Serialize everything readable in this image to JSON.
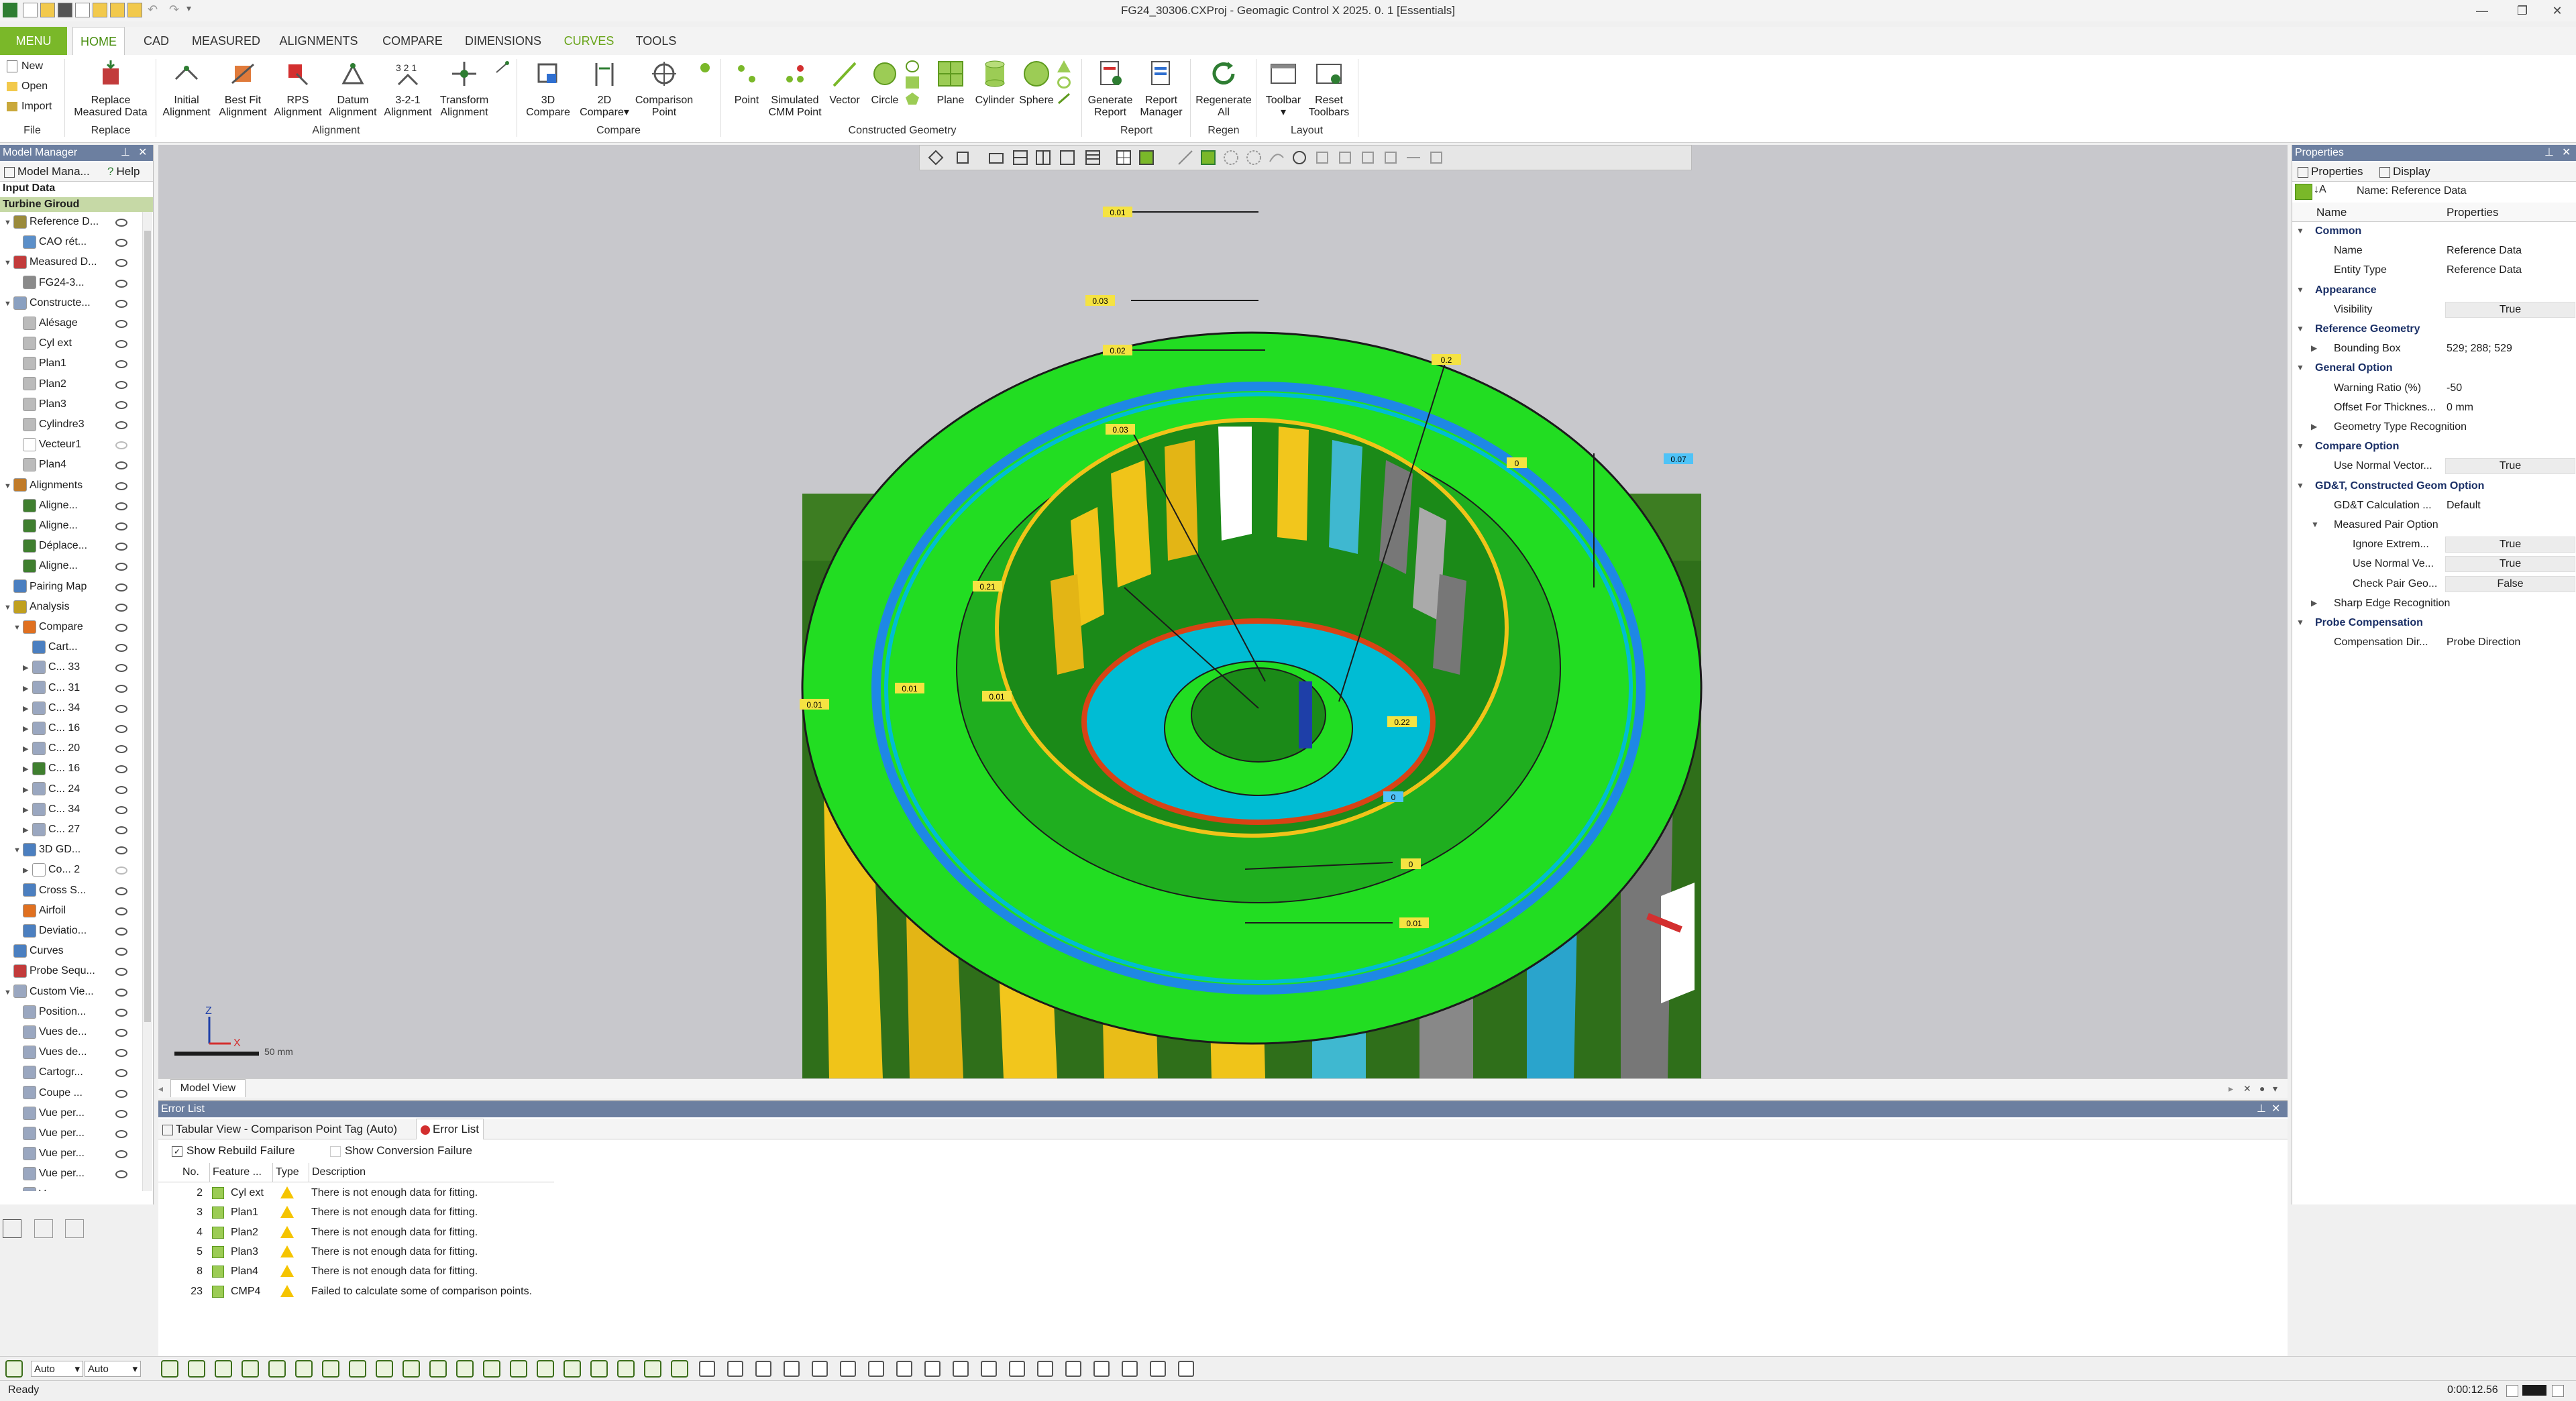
{
  "window": {
    "title": "FG24_30306.CXProj - Geomagic Control X 2025. 0. 1 [Essentials]",
    "controls": [
      "—",
      "❐",
      "✕"
    ]
  },
  "tabs": [
    {
      "label": "MENU"
    },
    {
      "label": "HOME"
    },
    {
      "label": "CAD"
    },
    {
      "label": "MEASURED"
    },
    {
      "label": "ALIGNMENTS"
    },
    {
      "label": "COMPARE"
    },
    {
      "label": "DIMENSIONS"
    },
    {
      "label": "CURVES"
    },
    {
      "label": "TOOLS"
    }
  ],
  "ribbon": {
    "file_items": [
      "New",
      "Open",
      "Import"
    ],
    "replace": [
      "Replace",
      "Measured Data"
    ],
    "alignment_buttons": [
      [
        "Initial",
        "Alignment"
      ],
      [
        "Best Fit",
        "Alignment"
      ],
      [
        "RPS",
        "Alignment"
      ],
      [
        "Datum",
        "Alignment"
      ],
      [
        "3-2-1",
        "Alignment"
      ],
      [
        "Transform",
        "Alignment"
      ]
    ],
    "compare_buttons": [
      [
        "3D",
        "Compare"
      ],
      [
        "2D",
        "Compare▾"
      ],
      [
        "Comparison",
        "Point"
      ]
    ],
    "geometry_buttons": [
      [
        "Point",
        ""
      ],
      [
        "Simulated",
        "CMM Point"
      ],
      [
        "Vector",
        ""
      ],
      [
        "Circle",
        ""
      ],
      [
        "Plane",
        ""
      ],
      [
        "Cylinder",
        ""
      ],
      [
        "Sphere",
        ""
      ]
    ],
    "report_buttons": [
      [
        "Generate",
        "Report"
      ],
      [
        "Report",
        "Manager"
      ]
    ],
    "regen_button": [
      "Regenerate",
      "All"
    ],
    "layout_buttons": [
      [
        "Toolbar",
        "▾"
      ],
      [
        "Reset",
        "Toolbars"
      ]
    ],
    "groups": [
      "File",
      "Replace",
      "Alignment",
      "Compare",
      "Constructed Geometry",
      "Report",
      "Regen",
      "Layout"
    ]
  },
  "model_manager": {
    "title": "Model Manager",
    "tabs": [
      "Model Mana...",
      "Help"
    ],
    "section": "Input Data",
    "root": "Turbine Giroud",
    "items": [
      {
        "label": "Reference D...",
        "level": 1,
        "expand": "▼",
        "color": "#9a8a3c"
      },
      {
        "label": "CAO rét...",
        "level": 2,
        "expand": "",
        "color": "#5b8fc9"
      },
      {
        "label": "Measured D...",
        "level": 1,
        "expand": "▼",
        "color": "#c23b3b"
      },
      {
        "label": "FG24-3...",
        "level": 2,
        "expand": "",
        "color": "#8a8a8a"
      },
      {
        "label": "Constructe...",
        "level": 1,
        "expand": "▼",
        "color": "#8aa0c0"
      },
      {
        "label": "Alésage",
        "level": 2,
        "expand": "",
        "color": "#bbbbbb"
      },
      {
        "label": "Cyl ext",
        "level": 2,
        "expand": "",
        "color": "#bbbbbb"
      },
      {
        "label": "Plan1",
        "level": 2,
        "expand": "",
        "color": "#bbbbbb"
      },
      {
        "label": "Plan2",
        "level": 2,
        "expand": "",
        "color": "#bbbbbb"
      },
      {
        "label": "Plan3",
        "level": 2,
        "expand": "",
        "color": "#bbbbbb"
      },
      {
        "label": "Cylindre3",
        "level": 2,
        "expand": "",
        "color": "#bbbbbb"
      },
      {
        "label": "Vecteur1",
        "level": 2,
        "expand": "",
        "color": "#ffffff"
      },
      {
        "label": "Plan4",
        "level": 2,
        "expand": "",
        "color": "#bbbbbb"
      },
      {
        "label": "Alignments",
        "level": 1,
        "expand": "▼",
        "color": "#c07b2a"
      },
      {
        "label": "Aligne...",
        "level": 2,
        "expand": "",
        "color": "#3f7f2f"
      },
      {
        "label": "Aligne...",
        "level": 2,
        "expand": "",
        "color": "#3f7f2f"
      },
      {
        "label": "Déplace...",
        "level": 2,
        "expand": "",
        "color": "#3f7f2f"
      },
      {
        "label": "Aligne...",
        "level": 2,
        "expand": "",
        "color": "#3f7f2f"
      },
      {
        "label": "Pairing Map",
        "level": 1,
        "expand": "",
        "color": "#4b7fc0"
      },
      {
        "label": "Analysis",
        "level": 1,
        "expand": "▼",
        "color": "#c0a020"
      },
      {
        "label": "Compare",
        "level": 2,
        "expand": "▼",
        "color": "#e07020"
      },
      {
        "label": "Cart...",
        "level": 3,
        "expand": "",
        "color": "#4b7fc0"
      },
      {
        "label": "C... 33",
        "level": 3,
        "expand": "▶",
        "color": "#9aa7c0"
      },
      {
        "label": "C... 31",
        "level": 3,
        "expand": "▶",
        "color": "#9aa7c0"
      },
      {
        "label": "C... 34",
        "level": 3,
        "expand": "▶",
        "color": "#9aa7c0"
      },
      {
        "label": "C... 16",
        "level": 3,
        "expand": "▶",
        "color": "#9aa7c0"
      },
      {
        "label": "C... 20",
        "level": 3,
        "expand": "▶",
        "color": "#9aa7c0"
      },
      {
        "label": "C... 16",
        "level": 3,
        "expand": "▶",
        "color": "#3f7f2f"
      },
      {
        "label": "C... 24",
        "level": 3,
        "expand": "▶",
        "color": "#9aa7c0"
      },
      {
        "label": "C... 34",
        "level": 3,
        "expand": "▶",
        "color": "#9aa7c0"
      },
      {
        "label": "C... 27",
        "level": 3,
        "expand": "▶",
        "color": "#9aa7c0"
      },
      {
        "label": "3D GD...",
        "level": 2,
        "expand": "▼",
        "color": "#4b7fc0"
      },
      {
        "label": "Co... 2",
        "level": 3,
        "expand": "▶",
        "color": "#ffffff"
      },
      {
        "label": "Cross S...",
        "level": 2,
        "expand": "",
        "color": "#4b7fc0"
      },
      {
        "label": "Airfoil",
        "level": 2,
        "expand": "",
        "color": "#e07020"
      },
      {
        "label": "Deviatio...",
        "level": 2,
        "expand": "",
        "color": "#4b7fc0"
      },
      {
        "label": "Curves",
        "level": 1,
        "expand": "",
        "color": "#4b7fc0"
      },
      {
        "label": "Probe Sequ...",
        "level": 1,
        "expand": "",
        "color": "#c23b3b"
      },
      {
        "label": "Custom Vie...",
        "level": 1,
        "expand": "▼",
        "color": "#9aa7c0"
      },
      {
        "label": "Position...",
        "level": 2,
        "expand": "",
        "color": "#9aa7c0"
      },
      {
        "label": "Vues de...",
        "level": 2,
        "expand": "",
        "color": "#9aa7c0"
      },
      {
        "label": "Vues de...",
        "level": 2,
        "expand": "",
        "color": "#9aa7c0"
      },
      {
        "label": "Cartogr...",
        "level": 2,
        "expand": "",
        "color": "#9aa7c0"
      },
      {
        "label": "Coupe ...",
        "level": 2,
        "expand": "",
        "color": "#9aa7c0"
      },
      {
        "label": "Vue per...",
        "level": 2,
        "expand": "",
        "color": "#9aa7c0"
      },
      {
        "label": "Vue per...",
        "level": 2,
        "expand": "",
        "color": "#9aa7c0"
      },
      {
        "label": "Vue per...",
        "level": 2,
        "expand": "",
        "color": "#9aa7c0"
      },
      {
        "label": "Vue per...",
        "level": 2,
        "expand": "",
        "color": "#9aa7c0"
      },
      {
        "label": "Vue per...",
        "level": 2,
        "expand": "",
        "color": "#9aa7c0"
      }
    ]
  },
  "viewport": {
    "tab_label": "Model View",
    "scale_label": "50 mm",
    "axis_z": "Z",
    "axis_x": "X",
    "tags": [
      "0.01",
      "0.03",
      "0.02",
      "0.2",
      "0.03",
      "0",
      "0.07",
      "0.21",
      "0.01",
      "0.01",
      "0.01",
      "0.22",
      "0",
      "0",
      "0.01"
    ]
  },
  "properties": {
    "title": "Properties",
    "tabs": [
      "Properties",
      "Display"
    ],
    "name_label": "Name: Reference Data",
    "columns": [
      "Name",
      "Properties"
    ],
    "rows": [
      {
        "label": "Common",
        "value": "",
        "cat": true,
        "indent": 0,
        "exp": "▼"
      },
      {
        "label": "Name",
        "value": "Reference Data",
        "cat": false,
        "indent": 1,
        "exp": ""
      },
      {
        "label": "Entity Type",
        "value": "Reference Data",
        "cat": false,
        "indent": 1,
        "exp": ""
      },
      {
        "label": "Appearance",
        "value": "",
        "cat": true,
        "indent": 0,
        "exp": "▼"
      },
      {
        "label": "Visibility",
        "value": "True",
        "cat": false,
        "indent": 1,
        "exp": "",
        "box": true
      },
      {
        "label": "Reference Geometry",
        "value": "",
        "cat": true,
        "indent": 0,
        "exp": "▼"
      },
      {
        "label": "Bounding Box",
        "value": "529; 288; 529",
        "cat": false,
        "indent": 1,
        "exp": "▶"
      },
      {
        "label": "General Option",
        "value": "",
        "cat": true,
        "indent": 0,
        "exp": "▼"
      },
      {
        "label": "Warning Ratio (%)",
        "value": "-50",
        "cat": false,
        "indent": 1,
        "exp": ""
      },
      {
        "label": "Offset For Thicknes...",
        "value": "0 mm",
        "cat": false,
        "indent": 1,
        "exp": ""
      },
      {
        "label": "Geometry Type Recognition",
        "value": "",
        "cat": false,
        "indent": 1,
        "exp": "▶"
      },
      {
        "label": "Compare Option",
        "value": "",
        "cat": true,
        "indent": 0,
        "exp": "▼"
      },
      {
        "label": "Use Normal Vector...",
        "value": "True",
        "cat": false,
        "indent": 1,
        "exp": "",
        "box": true
      },
      {
        "label": "GD&T, Constructed Geom Option",
        "value": "",
        "cat": true,
        "indent": 0,
        "exp": "▼"
      },
      {
        "label": "GD&T Calculation ...",
        "value": "Default",
        "cat": false,
        "indent": 1,
        "exp": ""
      },
      {
        "label": "Measured Pair Option",
        "value": "",
        "cat": false,
        "indent": 1,
        "exp": "▼"
      },
      {
        "label": "Ignore Extrem...",
        "value": "True",
        "cat": false,
        "indent": 2,
        "exp": "",
        "box": true
      },
      {
        "label": "Use Normal Ve...",
        "value": "True",
        "cat": false,
        "indent": 2,
        "exp": "",
        "box": true
      },
      {
        "label": "Check Pair Geo...",
        "value": "False",
        "cat": false,
        "indent": 2,
        "exp": "",
        "box": true
      },
      {
        "label": "Sharp Edge Recognition",
        "value": "",
        "cat": false,
        "indent": 1,
        "exp": "▶"
      },
      {
        "label": "Probe Compensation",
        "value": "",
        "cat": true,
        "indent": 0,
        "exp": "▼"
      },
      {
        "label": "Compensation Dir...",
        "value": "Probe Direction",
        "cat": false,
        "indent": 1,
        "exp": ""
      }
    ]
  },
  "error_list": {
    "title": "Error List",
    "tabs": [
      "Tabular View - Comparison Point Tag (Auto)",
      "Error List"
    ],
    "checkboxes": [
      {
        "label": "Show Rebuild Failure",
        "checked": true
      },
      {
        "label": "Show Conversion Failure",
        "checked": false
      }
    ],
    "columns": [
      "No.",
      "Feature ...",
      "Type",
      "Description"
    ],
    "rows": [
      {
        "no": "2",
        "feature": "Cyl ext",
        "desc": "There is not enough data for fitting."
      },
      {
        "no": "3",
        "feature": "Plan1",
        "desc": "There is not enough data for fitting."
      },
      {
        "no": "4",
        "feature": "Plan2",
        "desc": "There is not enough data for fitting."
      },
      {
        "no": "5",
        "feature": "Plan3",
        "desc": "There is not enough data for fitting."
      },
      {
        "no": "8",
        "feature": "Plan4",
        "desc": "There is not enough data for fitting."
      },
      {
        "no": "23",
        "feature": "CMP4",
        "desc": "Failed to calculate some of comparison points."
      }
    ]
  },
  "bottom_toolbar": {
    "select1": "Auto",
    "select2": "Auto"
  },
  "status": {
    "left": "Ready",
    "time": "0:00:12.56"
  },
  "colors": {
    "accent": "#7ab829",
    "panel_header": "#6c7fa0",
    "viewport_bg": "#c8c8cc",
    "deviation_green": "#22dd22",
    "warning": "#f5c400"
  }
}
